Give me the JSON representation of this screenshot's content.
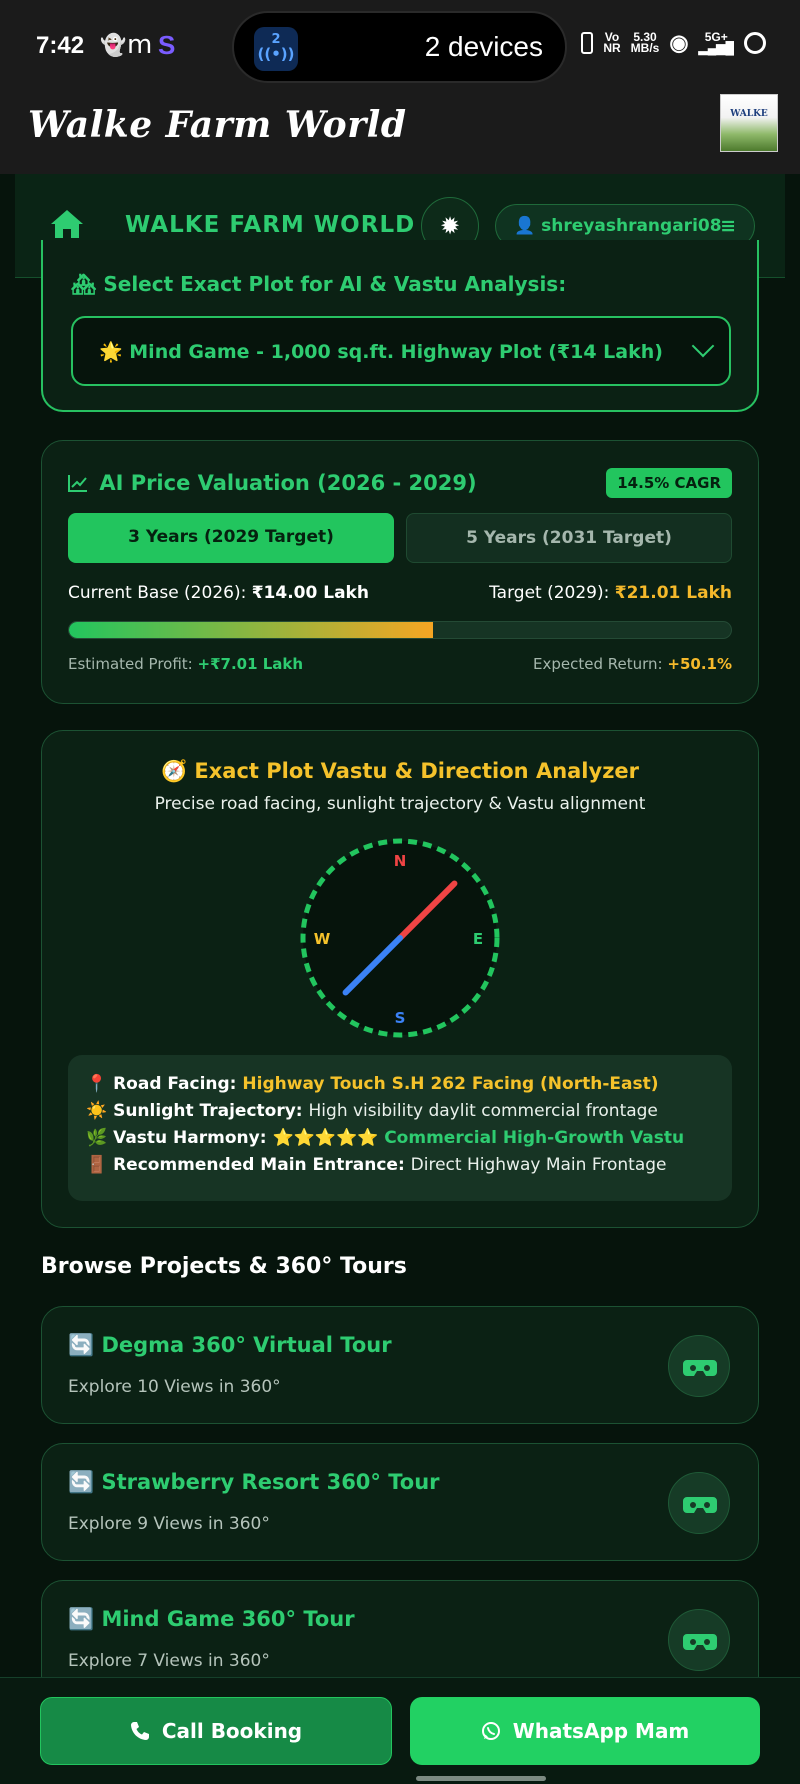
{
  "status_bar": {
    "time": "7:42",
    "notif_m": "m",
    "notif_s": "S",
    "island_badge": "2",
    "island_text": "2 devices",
    "volte_top": "Vo",
    "volte_bottom": "NR",
    "speed_top": "5.30",
    "speed_bottom": "MB/s",
    "network": "5G+"
  },
  "app_bar": {
    "title": "Walke Farm World",
    "thumb_text": "WALKE"
  },
  "nav": {
    "brand": "WALKE FARM WORLD",
    "username": "shreyashrangari08"
  },
  "plot_select": {
    "label": "🏘 Select Exact Plot for AI & Vastu Analysis:",
    "selected": "🌟 Mind Game - 1,000 sq.ft. Highway Plot (₹14 Lakh)"
  },
  "valuation": {
    "title": "AI Price Valuation (2026 - 2029)",
    "cagr_badge": "14.5% CAGR",
    "tab_active": "3 Years (2029 Target)",
    "tab_inactive": "5 Years (2031 Target)",
    "base_label": "Current Base (2026): ",
    "base_value": "₹14.00 Lakh",
    "target_label": "Target (2029): ",
    "target_value": "₹21.01 Lakh",
    "progress_fraction": 0.55,
    "profit_label": "Estimated Profit: ",
    "profit_value": "+₹7.01 Lakh",
    "return_label": "Expected Return: ",
    "return_value": "+50.1%"
  },
  "vastu": {
    "title": "🧭 Exact Plot Vastu & Direction Analyzer",
    "subtitle": "Precise road facing, sunlight trajectory & Vastu alignment",
    "compass": {
      "n": "N",
      "s": "S",
      "e": "E",
      "w": "W",
      "needle_bearing_deg": 45
    },
    "road_label": "📍 Road Facing: ",
    "road_value": "Highway Touch S.H 262 Facing (North-East)",
    "sun_label": "☀️ Sunlight Trajectory: ",
    "sun_value": "High visibility daylit commercial frontage",
    "harmony_label": "🌿 Vastu Harmony: ",
    "harmony_stars": "⭐⭐⭐⭐⭐",
    "harmony_value": " Commercial High-Growth Vastu",
    "entrance_label": "🚪 Recommended Main Entrance: ",
    "entrance_value": "Direct Highway Main Frontage"
  },
  "browse": {
    "heading": "Browse Projects & 360° Tours",
    "tours": [
      {
        "title": "🔄 Degma 360° Virtual Tour",
        "subtitle": "Explore 10 Views in 360°"
      },
      {
        "title": "🔄 Strawberry Resort 360° Tour",
        "subtitle": "Explore 9 Views in 360°"
      },
      {
        "title": "🔄 Mind Game 360° Tour",
        "subtitle": "Explore 7 Views in 360°"
      }
    ]
  },
  "bottom": {
    "call_label": "Call Booking",
    "whatsapp_label": "WhatsApp Mam"
  },
  "colors": {
    "accent_green": "#2ecc71",
    "button_green": "#22c55e",
    "gold": "#f5c22b",
    "needle_red": "#ef4444",
    "needle_blue": "#3b82f6"
  }
}
